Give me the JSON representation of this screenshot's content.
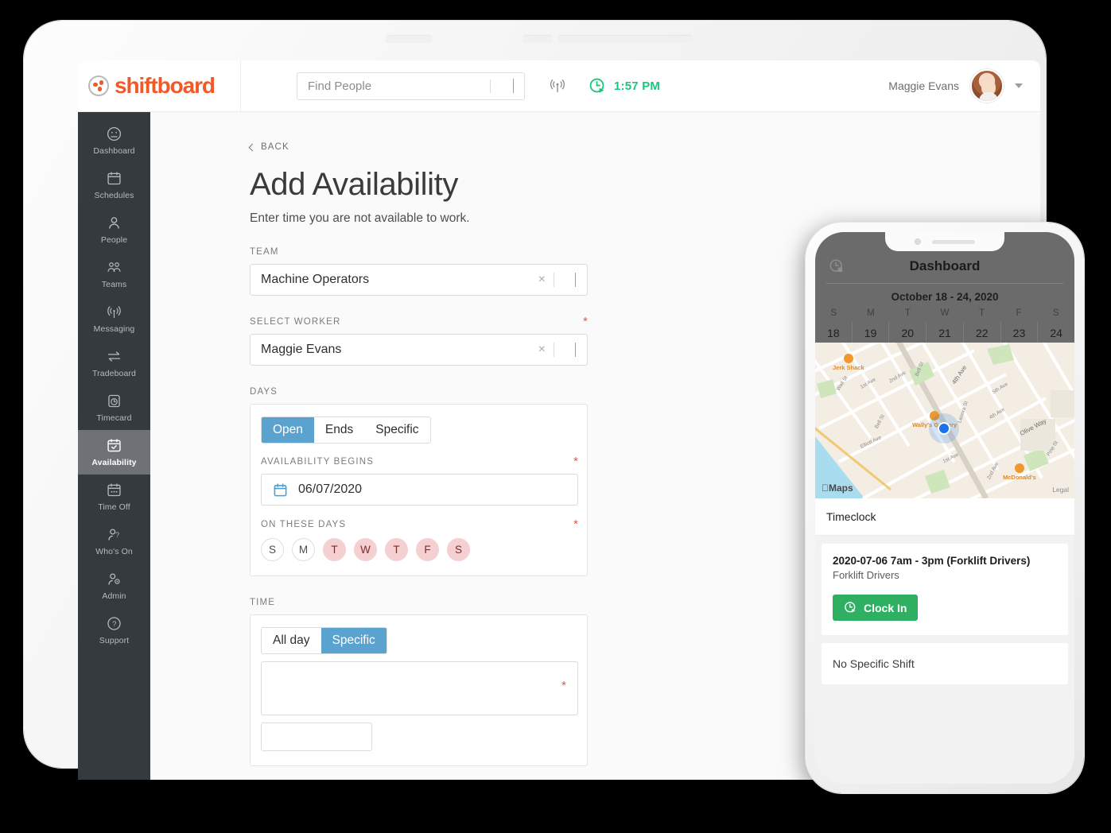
{
  "tablet": {
    "topbar": {
      "brand": "shiftboard",
      "search_placeholder": "Find People",
      "clock_time": "1:57 PM",
      "user_name": "Maggie Evans",
      "icons": [
        "broadcast-icon",
        "clock-play-icon",
        "chevron-down-icon"
      ]
    },
    "sidebar": {
      "items": [
        {
          "label": "Dashboard",
          "icon": "dashboard-icon",
          "active": false
        },
        {
          "label": "Schedules",
          "icon": "calendar-icon",
          "active": false
        },
        {
          "label": "People",
          "icon": "person-icon",
          "active": false
        },
        {
          "label": "Teams",
          "icon": "people-icon",
          "active": false
        },
        {
          "label": "Messaging",
          "icon": "broadcast-icon",
          "active": false
        },
        {
          "label": "Tradeboard",
          "icon": "exchange-icon",
          "active": false
        },
        {
          "label": "Timecard",
          "icon": "stopwatch-icon",
          "active": false
        },
        {
          "label": "Availability",
          "icon": "calendar-check-icon",
          "active": true
        },
        {
          "label": "Time Off",
          "icon": "calendar-dots-icon",
          "active": false
        },
        {
          "label": "Who's On",
          "icon": "person-query-icon",
          "active": false
        },
        {
          "label": "Admin",
          "icon": "person-gear-icon",
          "active": false
        },
        {
          "label": "Support",
          "icon": "question-icon",
          "active": false
        }
      ]
    },
    "content": {
      "back_label": "BACK",
      "title": "Add Availability",
      "subtitle": "Enter time you are not available to work.",
      "team_label": "TEAM",
      "team_value": "Machine Operators",
      "worker_label": "SELECT WORKER",
      "worker_value": "Maggie Evans",
      "days_label": "DAYS",
      "days_tabs": [
        {
          "label": "Open",
          "active": true
        },
        {
          "label": "Ends",
          "active": false
        },
        {
          "label": "Specific",
          "active": false
        }
      ],
      "begins_label": "AVAILABILITY BEGINS",
      "begins_value": "06/07/2020",
      "on_days_label": "ON THESE DAYS",
      "day_chips": [
        {
          "label": "S",
          "selected": false
        },
        {
          "label": "M",
          "selected": false
        },
        {
          "label": "T",
          "selected": true
        },
        {
          "label": "W",
          "selected": true
        },
        {
          "label": "T",
          "selected": true
        },
        {
          "label": "F",
          "selected": true
        },
        {
          "label": "S",
          "selected": true
        }
      ],
      "time_label": "TIME",
      "time_tabs": [
        {
          "label": "All day",
          "active": false
        },
        {
          "label": "Specific",
          "active": true
        }
      ],
      "required_marker": "*",
      "clear_marker": "×"
    }
  },
  "phone": {
    "title": "Dashboard",
    "week_range": "October 18 - 24, 2020",
    "dow": [
      "S",
      "M",
      "T",
      "W",
      "T",
      "F",
      "S"
    ],
    "dates": [
      {
        "num": "18",
        "dot": false
      },
      {
        "num": "19",
        "dot": true
      },
      {
        "num": "20",
        "dot": true
      },
      {
        "num": "21",
        "dot": true
      },
      {
        "num": "22",
        "dot": true
      },
      {
        "num": "23",
        "dot": true
      },
      {
        "num": "24",
        "dot": false
      }
    ],
    "map": {
      "attribution": "Maps",
      "legal": "Legal",
      "pois": [
        "Jerk Shack",
        "Wally's Grocery",
        "McDonald's"
      ],
      "streets": [
        "Wall St",
        "1st Ave",
        "2nd Ave",
        "Bell St",
        "4th Ave",
        "5th Ave",
        "Lenora St",
        "Elliott Ave",
        "Olive Way",
        "Pine St",
        "1st Ave",
        "2nd Ave",
        "Bell St",
        "4th Ave",
        "Ave"
      ]
    },
    "timeclock_label": "Timeclock",
    "shift": {
      "title": "2020-07-06 7am - 3pm (Forklift Drivers)",
      "team": "Forklift Drivers",
      "button": "Clock In"
    },
    "no_shift_label": "No Specific Shift"
  },
  "colors": {
    "brand_orange": "#f05a28",
    "accent_blue": "#5ba3cf",
    "clock_green": "#16c97a",
    "clockin_green": "#2eaf62",
    "chip_pink": "#f5d0d2",
    "required_red": "#e2574c",
    "sidebar_dark": "#353a3f"
  }
}
